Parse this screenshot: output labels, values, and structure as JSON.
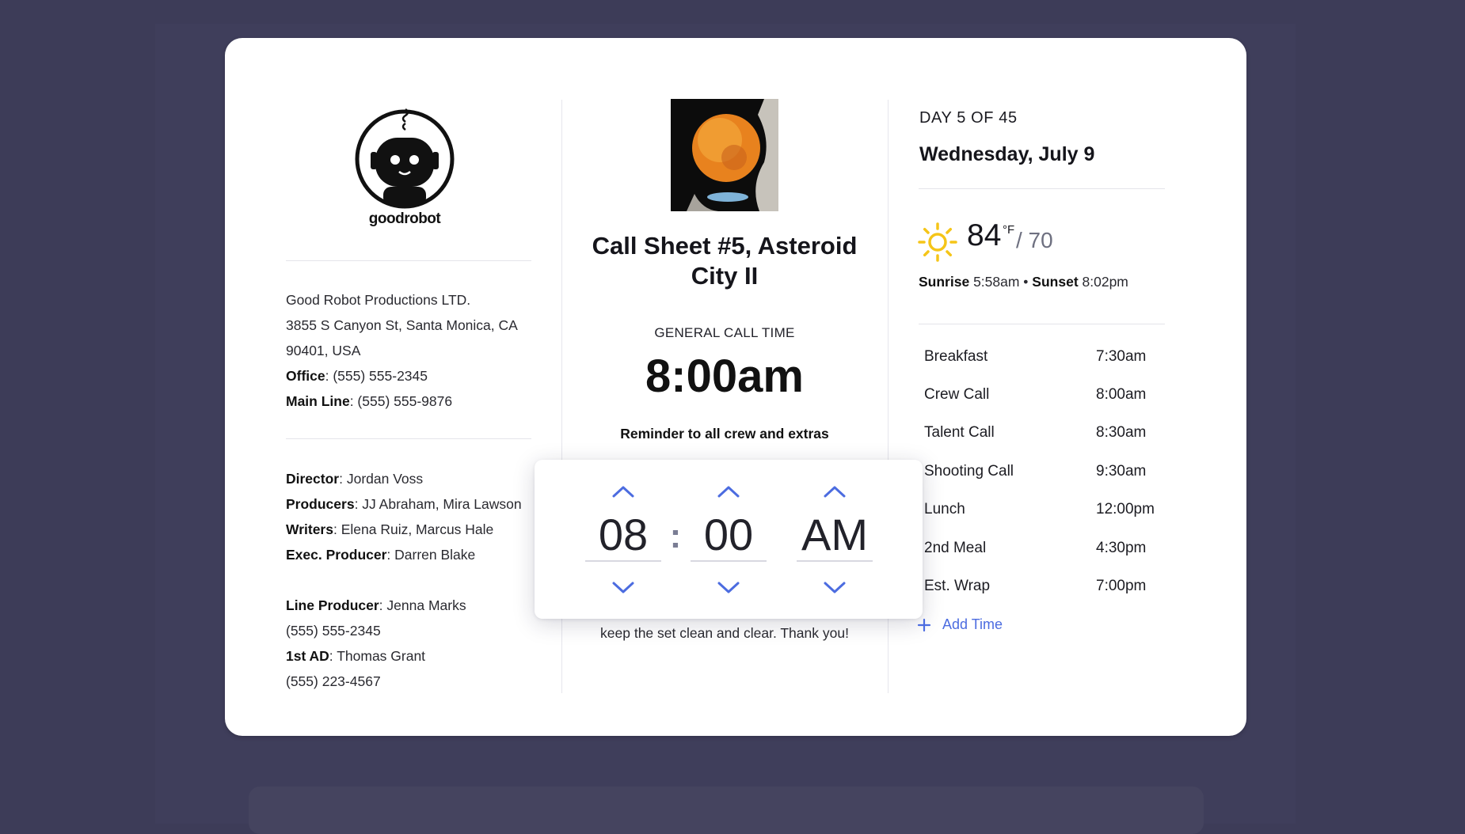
{
  "company": {
    "logo_text": "goodrobot",
    "name": "Good Robot Productions LTD.",
    "address_line1": "3855 S Canyon St, Santa Monica, CA",
    "address_line2": "90401, USA",
    "office_label": "Office",
    "office_phone": ": (555) 555-2345",
    "mainline_label": "Main Line",
    "mainline_phone": ": (555) 555-9876"
  },
  "crew": {
    "director_label": "Director",
    "director": ": Jordan Voss",
    "producers_label": "Producers",
    "producers": ": JJ Abraham, Mira Lawson",
    "writers_label": "Writers",
    "writers": ": Elena Ruiz, Marcus Hale",
    "exec_label": "Exec. Producer",
    "exec": ": Darren Blake",
    "line_producer_label": "Line Producer",
    "line_producer": ": Jenna Marks",
    "line_producer_phone": "(555) 555-2345",
    "first_ad_label": "1st AD",
    "first_ad": ": Thomas Grant",
    "first_ad_phone": "(555) 223-4567"
  },
  "callsheet": {
    "title": "Call Sheet #5, Asteroid City II",
    "general_call_label": "GENERAL CALL TIME",
    "general_call_time": "8:00am",
    "reminder_heading": "Reminder to all crew and extras",
    "reminder_tail": "keep the set clean and clear. Thank you!"
  },
  "time_picker": {
    "hour": "08",
    "separator": ":",
    "minute": "00",
    "period": "AM"
  },
  "day": {
    "label": "DAY 5 OF 45",
    "date": "Wednesday, July 9"
  },
  "weather": {
    "icon": "sun-icon",
    "high": "84",
    "unit": "°F",
    "low": "/ 70",
    "sunrise_label": "Sunrise",
    "sunrise": " 5:58am • ",
    "sunset_label": "Sunset",
    "sunset": " 8:02pm"
  },
  "schedule": [
    {
      "label": "Breakfast",
      "time": "7:30am"
    },
    {
      "label": "Crew Call",
      "time": "8:00am"
    },
    {
      "label": "Talent Call",
      "time": "8:30am"
    },
    {
      "label": "Shooting Call",
      "time": "9:30am"
    },
    {
      "label": "Lunch",
      "time": "12:00pm"
    },
    {
      "label": "2nd Meal",
      "time": "4:30pm"
    },
    {
      "label": "Est. Wrap",
      "time": "7:00pm"
    }
  ],
  "add_time_label": "Add Time",
  "colors": {
    "background": "#3d3c58",
    "accent": "#4c6ce0",
    "sun": "#f5c518"
  }
}
